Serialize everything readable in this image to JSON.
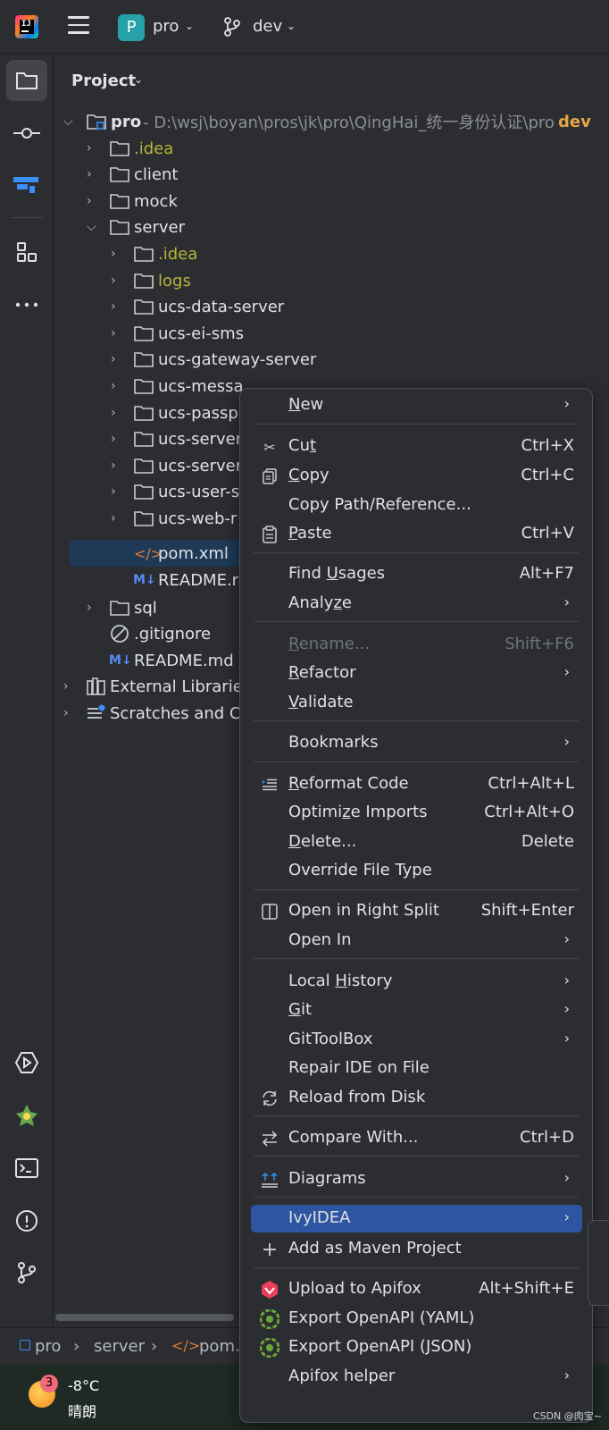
{
  "titlebar": {
    "project_badge": "P",
    "project_name": "pro",
    "branch_name": "dev"
  },
  "panel": {
    "title": "Project"
  },
  "tree": [
    {
      "label": "pro",
      "path": " - D:\\wsj\\boyan\\pros\\jk\\pro\\QingHai_统一身份认证\\pro",
      "branch": "dev"
    },
    {
      "label": ".idea"
    },
    {
      "label": "client"
    },
    {
      "label": "mock"
    },
    {
      "label": "server"
    },
    {
      "label": ".idea"
    },
    {
      "label": "logs"
    },
    {
      "label": "ucs-data-server"
    },
    {
      "label": "ucs-ei-sms"
    },
    {
      "label": "ucs-gateway-server"
    },
    {
      "label": "ucs-messa"
    },
    {
      "label": "ucs-passpo"
    },
    {
      "label": "ucs-server"
    },
    {
      "label": "ucs-server"
    },
    {
      "label": "ucs-user-s"
    },
    {
      "label": "ucs-web-r"
    },
    {
      "label": "pom.xml"
    },
    {
      "label": "README.r"
    },
    {
      "label": "sql"
    },
    {
      "label": ".gitignore"
    },
    {
      "label": "README.md"
    },
    {
      "label": "External Libraries"
    },
    {
      "label": "Scratches and Co"
    }
  ],
  "breadcrumbs": [
    "pro",
    "server",
    "pom.x"
  ],
  "context_menu": {
    "items": [
      {
        "label": "New",
        "mnemonic_pre": "",
        "mnemonic": "N",
        "mnemonic_post": "ew",
        "shortcut": "",
        "submenu": true
      },
      {
        "label": "Cut",
        "mnemonic_pre": "Cu",
        "mnemonic": "t",
        "mnemonic_post": "",
        "shortcut": "Ctrl+X"
      },
      {
        "label": "Copy",
        "mnemonic_pre": "",
        "mnemonic": "C",
        "mnemonic_post": "opy",
        "shortcut": "Ctrl+C"
      },
      {
        "label": "Copy Path/Reference...",
        "shortcut": ""
      },
      {
        "label": "Paste",
        "mnemonic_pre": "",
        "mnemonic": "P",
        "mnemonic_post": "aste",
        "shortcut": "Ctrl+V"
      },
      {
        "label": "Find Usages",
        "mnemonic_pre": "Find ",
        "mnemonic": "U",
        "mnemonic_post": "sages",
        "shortcut": "Alt+F7"
      },
      {
        "label": "Analyze",
        "mnemonic_pre": "Analy",
        "mnemonic": "z",
        "mnemonic_post": "e",
        "submenu": true
      },
      {
        "label": "Rename...",
        "mnemonic_pre": "",
        "mnemonic": "R",
        "mnemonic_post": "ename...",
        "shortcut": "Shift+F6",
        "disabled": true
      },
      {
        "label": "Refactor",
        "mnemonic_pre": "",
        "mnemonic": "R",
        "mnemonic_post": "efactor",
        "submenu": true
      },
      {
        "label": "Validate",
        "mnemonic_pre": "",
        "mnemonic": "V",
        "mnemonic_post": "alidate"
      },
      {
        "label": "Bookmarks",
        "submenu": true
      },
      {
        "label": "Reformat Code",
        "mnemonic_pre": "",
        "mnemonic": "R",
        "mnemonic_post": "eformat Code",
        "shortcut": "Ctrl+Alt+L"
      },
      {
        "label": "Optimize Imports",
        "mnemonic_pre": "Optimi",
        "mnemonic": "z",
        "mnemonic_post": "e Imports",
        "shortcut": "Ctrl+Alt+O"
      },
      {
        "label": "Delete...",
        "mnemonic_pre": "",
        "mnemonic": "D",
        "mnemonic_post": "elete...",
        "shortcut": "Delete"
      },
      {
        "label": "Override File Type"
      },
      {
        "label": "Open in Right Split",
        "shortcut": "Shift+Enter"
      },
      {
        "label": "Open In",
        "submenu": true
      },
      {
        "label": "Local History",
        "mnemonic_pre": "Local ",
        "mnemonic": "H",
        "mnemonic_post": "istory",
        "submenu": true
      },
      {
        "label": "Git",
        "mnemonic_pre": "",
        "mnemonic": "G",
        "mnemonic_post": "it",
        "submenu": true
      },
      {
        "label": "GitToolBox",
        "submenu": true
      },
      {
        "label": "Repair IDE on File"
      },
      {
        "label": "Reload from Disk"
      },
      {
        "label": "Compare With...",
        "shortcut": "Ctrl+D"
      },
      {
        "label": "Diagrams",
        "submenu": true
      },
      {
        "label": "IvyIDEA",
        "submenu": true,
        "highlighted": true
      },
      {
        "label": "Add as Maven Project"
      },
      {
        "label": "Upload to Apifox",
        "shortcut": "Alt+Shift+E"
      },
      {
        "label": "Export OpenAPI (YAML)"
      },
      {
        "label": "Export OpenAPI (JSON)"
      },
      {
        "label": "Apifox helper",
        "submenu": true
      }
    ]
  },
  "taskbar": {
    "weather_badge": "3",
    "temperature": "-8°C",
    "condition": "晴朗"
  },
  "watermark": "CSDN @肉宝~",
  "colors": {
    "background": "#2b2d30",
    "menu_highlight": "#2e55a1",
    "selection": "#1e3a57",
    "excluded_folder": "#b5b63a"
  }
}
